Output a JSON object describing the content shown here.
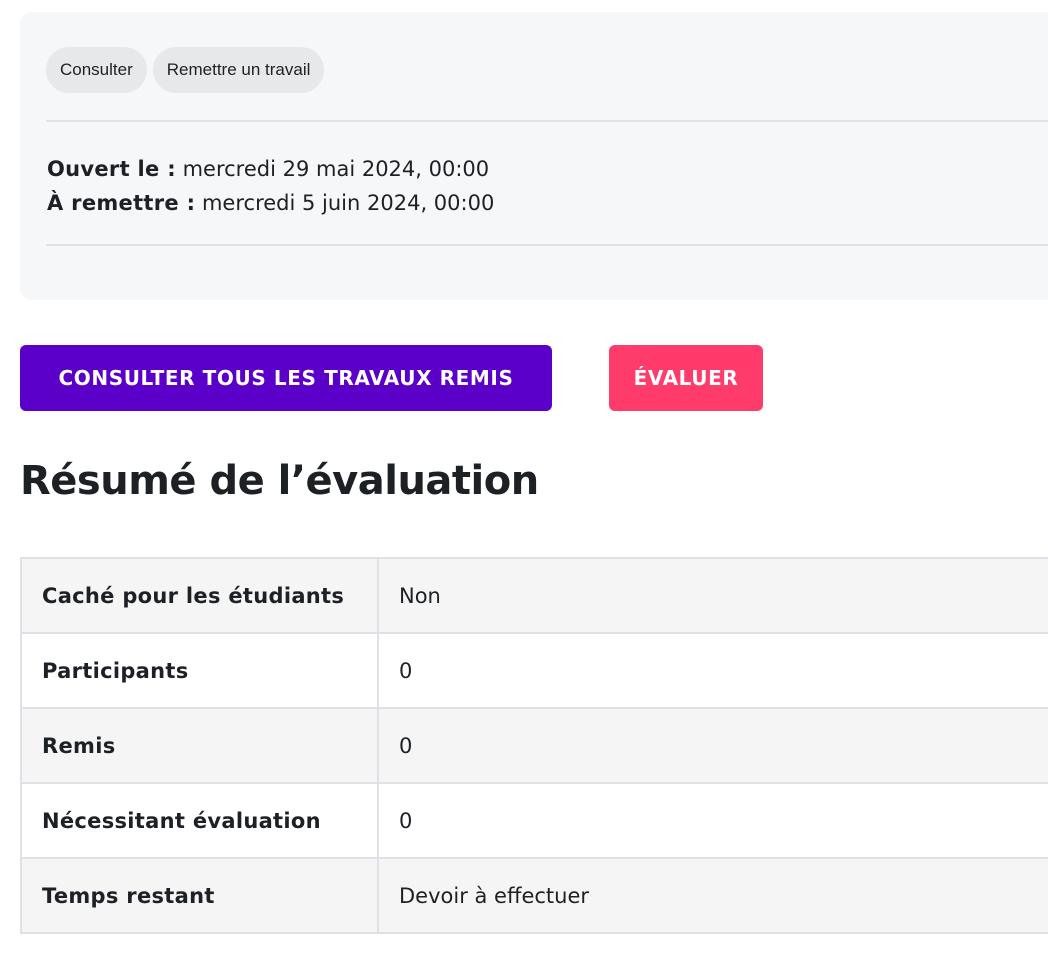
{
  "nav_pills": [
    {
      "label": "Consulter"
    },
    {
      "label": "Remettre un travail"
    }
  ],
  "dates": {
    "opened_label": "Ouvert le :",
    "opened_value": "mercredi 29 mai 2024, 00:00",
    "due_label": "À remettre :",
    "due_value": "mercredi 5 juin 2024, 00:00"
  },
  "buttons": {
    "view_all_label": "CONSULTER TOUS LES TRAVAUX REMIS",
    "grade_label": "ÉVALUER"
  },
  "summary": {
    "title": "Résumé de l’évaluation",
    "rows": [
      {
        "label": "Caché pour les étudiants",
        "value": "Non"
      },
      {
        "label": "Participants",
        "value": "0"
      },
      {
        "label": "Remis",
        "value": "0"
      },
      {
        "label": "Nécessitant évaluation",
        "value": "0"
      },
      {
        "label": "Temps restant",
        "value": "Devoir à effectuer"
      }
    ]
  },
  "colors": {
    "primary_button": "#5a00c8",
    "grade_button": "#ff3b6b",
    "panel_background": "#f5f7f9"
  }
}
